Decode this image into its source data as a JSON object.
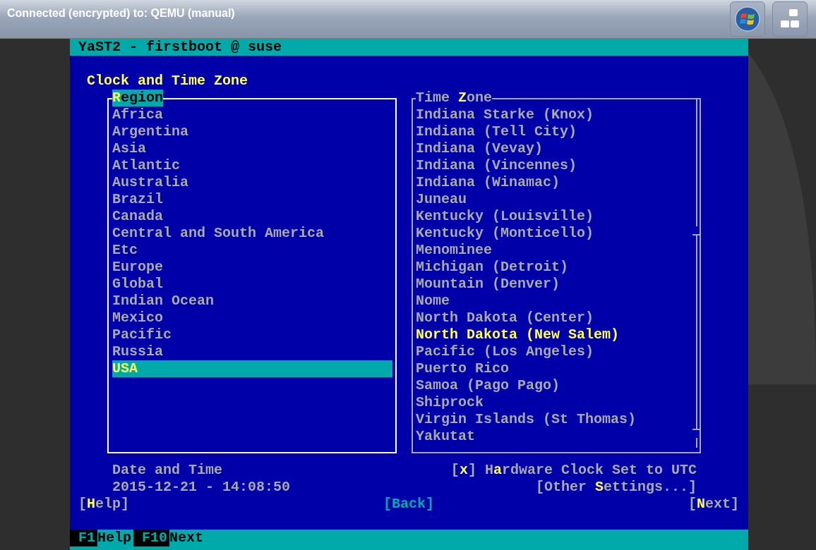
{
  "connection_bar": {
    "title": "Connected (encrypted) to: QEMU (manual)"
  },
  "terminal": {
    "title": "YaST2 - firstboot @ suse",
    "heading": "Clock and Time Zone",
    "region": {
      "label": "**R**egion",
      "focused": true,
      "items": [
        {
          "label": "Africa",
          "selected": false
        },
        {
          "label": "Argentina",
          "selected": false
        },
        {
          "label": "Asia",
          "selected": false
        },
        {
          "label": "Atlantic",
          "selected": false
        },
        {
          "label": "Australia",
          "selected": false
        },
        {
          "label": "Brazil",
          "selected": false
        },
        {
          "label": "Canada",
          "selected": false
        },
        {
          "label": "Central and South America",
          "selected": false
        },
        {
          "label": "Etc",
          "selected": false
        },
        {
          "label": "Europe",
          "selected": false
        },
        {
          "label": "Global",
          "selected": false
        },
        {
          "label": "Indian Ocean",
          "selected": false
        },
        {
          "label": "Mexico",
          "selected": false
        },
        {
          "label": "Pacific",
          "selected": false
        },
        {
          "label": "Russia",
          "selected": false
        },
        {
          "label": "USA",
          "selected": true
        }
      ]
    },
    "time_zone": {
      "label": "Time **Z**one",
      "focused": false,
      "items": [
        {
          "label": "Indiana Starke (Knox)",
          "selected": false
        },
        {
          "label": "Indiana (Tell City)",
          "selected": false
        },
        {
          "label": "Indiana (Vevay)",
          "selected": false
        },
        {
          "label": "Indiana (Vincennes)",
          "selected": false
        },
        {
          "label": "Indiana (Winamac)",
          "selected": false
        },
        {
          "label": "Juneau",
          "selected": false
        },
        {
          "label": "Kentucky (Louisville)",
          "selected": false
        },
        {
          "label": "Kentucky (Monticello)",
          "selected": false
        },
        {
          "label": "Menominee",
          "selected": false
        },
        {
          "label": "Michigan (Detroit)",
          "selected": false
        },
        {
          "label": "Mountain (Denver)",
          "selected": false
        },
        {
          "label": "Nome",
          "selected": false
        },
        {
          "label": "North Dakota (Center)",
          "selected": false
        },
        {
          "label": "North Dakota (New Salem)",
          "selected": true
        },
        {
          "label": "Pacific (Los Angeles)",
          "selected": false
        },
        {
          "label": "Puerto Rico",
          "selected": false
        },
        {
          "label": "Samoa (Pago Pago)",
          "selected": false
        },
        {
          "label": "Shiprock",
          "selected": false
        },
        {
          "label": "Virgin Islands (St Thomas)",
          "selected": false
        },
        {
          "label": "Yakutat",
          "selected": false
        }
      ]
    },
    "date_time": {
      "label": "Date and Time",
      "value": "2015-12-21 - 14:08:50"
    },
    "hardware_clock": {
      "box": "[**x**]",
      "label": "H**a**rdware Clock Set to UTC",
      "checked": true
    },
    "other_settings": "[Other **S**ettings...]",
    "buttons": [
      {
        "label": "[**H**elp]",
        "kind": "normal"
      },
      {
        "label": "[Back]",
        "kind": "focused"
      },
      {
        "label": "[**N**ext]",
        "kind": "normal"
      }
    ],
    "function_keys": [
      {
        "key": "F1",
        "label": "Help"
      },
      {
        "key": "F10",
        "label": "Next"
      }
    ]
  }
}
